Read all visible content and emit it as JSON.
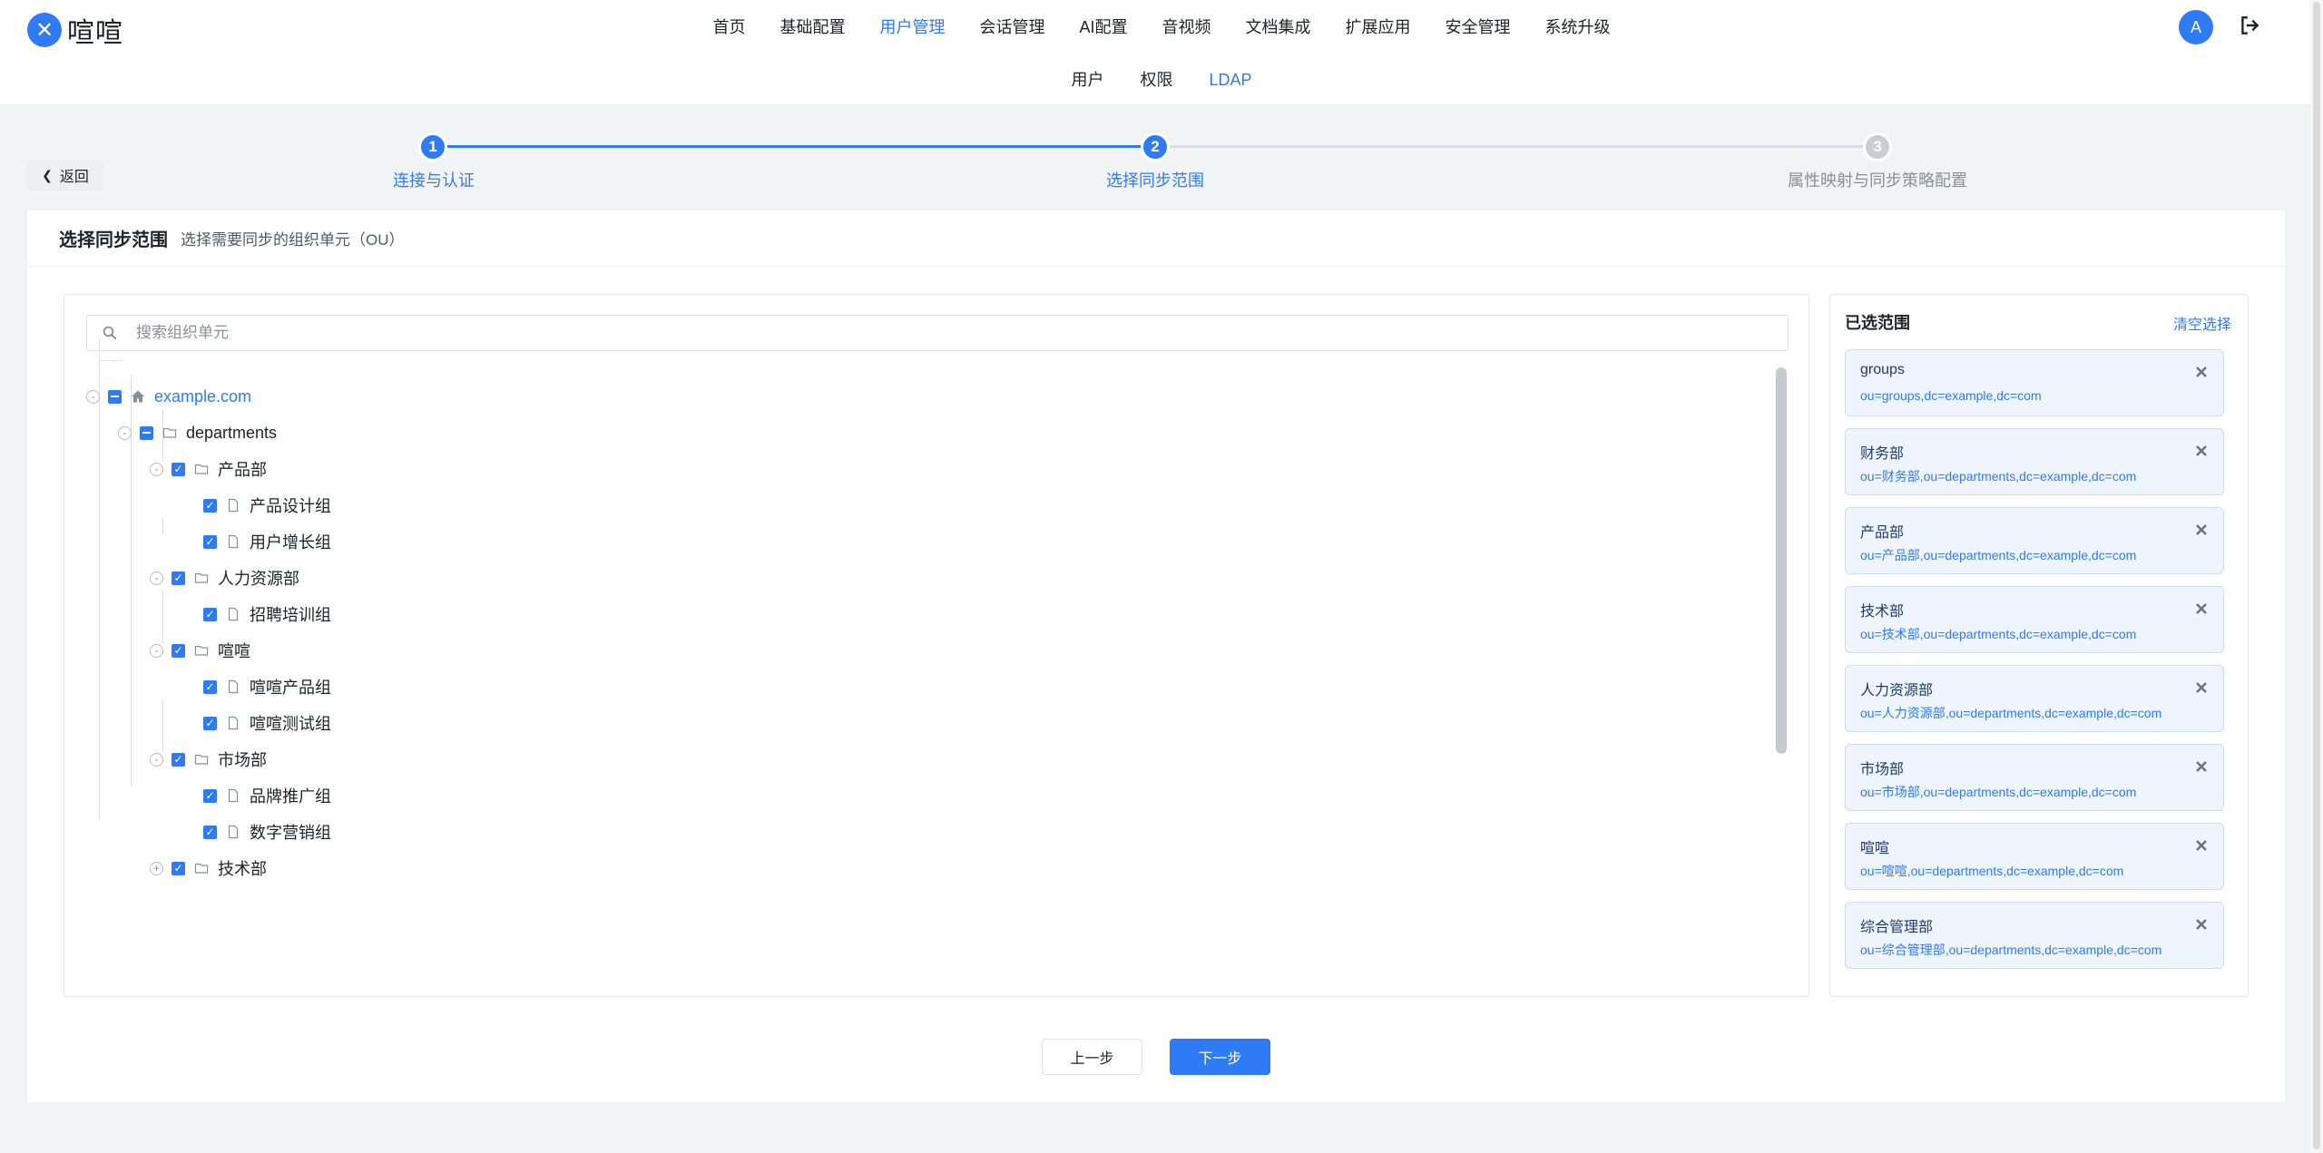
{
  "app": {
    "logo_text": "喧喧",
    "logo_mark": "✕"
  },
  "mainnav": [
    {
      "label": "首页"
    },
    {
      "label": "基础配置"
    },
    {
      "label": "用户管理",
      "active": true
    },
    {
      "label": "会话管理"
    },
    {
      "label": "AI配置"
    },
    {
      "label": "音视频"
    },
    {
      "label": "文档集成"
    },
    {
      "label": "扩展应用"
    },
    {
      "label": "安全管理"
    },
    {
      "label": "系统升级"
    }
  ],
  "subnav": [
    {
      "label": "用户"
    },
    {
      "label": "权限"
    },
    {
      "label": "LDAP",
      "active": true
    }
  ],
  "user": {
    "avatar_letter": "A"
  },
  "back": {
    "label": "返回"
  },
  "steps": [
    {
      "num": "1",
      "label": "连接与认证",
      "state": "done"
    },
    {
      "num": "2",
      "label": "选择同步范围",
      "state": "current"
    },
    {
      "num": "3",
      "label": "属性映射与同步策略配置",
      "state": "pending"
    }
  ],
  "card": {
    "title": "选择同步范围",
    "subtitle": "选择需要同步的组织单元（OU）"
  },
  "search": {
    "placeholder": "搜索组织单元",
    "value": ""
  },
  "tree": {
    "root": "example.com",
    "departments": "departments",
    "items": [
      {
        "label": "产品部"
      },
      {
        "label": "产品设计组"
      },
      {
        "label": "用户增长组"
      },
      {
        "label": "人力资源部"
      },
      {
        "label": "招聘培训组"
      },
      {
        "label": "喧喧"
      },
      {
        "label": "喧喧产品组"
      },
      {
        "label": "喧喧测试组"
      },
      {
        "label": "市场部"
      },
      {
        "label": "品牌推广组"
      },
      {
        "label": "数字营销组"
      },
      {
        "label": "技术部"
      }
    ]
  },
  "selected": {
    "title": "已选范围",
    "clear_label": "清空选择",
    "items": [
      {
        "name": "groups",
        "dn": "ou=groups,dc=example,dc=com"
      },
      {
        "name": "财务部",
        "dn": "ou=财务部,ou=departments,dc=example,dc=com"
      },
      {
        "name": "产品部",
        "dn": "ou=产品部,ou=departments,dc=example,dc=com"
      },
      {
        "name": "技术部",
        "dn": "ou=技术部,ou=departments,dc=example,dc=com"
      },
      {
        "name": "人力资源部",
        "dn": "ou=人力资源部,ou=departments,dc=example,dc=com"
      },
      {
        "name": "市场部",
        "dn": "ou=市场部,ou=departments,dc=example,dc=com"
      },
      {
        "name": "喧喧",
        "dn": "ou=喧喧,ou=departments,dc=example,dc=com"
      },
      {
        "name": "综合管理部",
        "dn": "ou=综合管理部,ou=departments,dc=example,dc=com"
      }
    ]
  },
  "footer": {
    "prev_label": "上一步",
    "next_label": "下一步"
  },
  "colors": {
    "accent": "#2f7bf5",
    "pending": "#c9cdd4",
    "selected_bg": "#eef5ff"
  }
}
